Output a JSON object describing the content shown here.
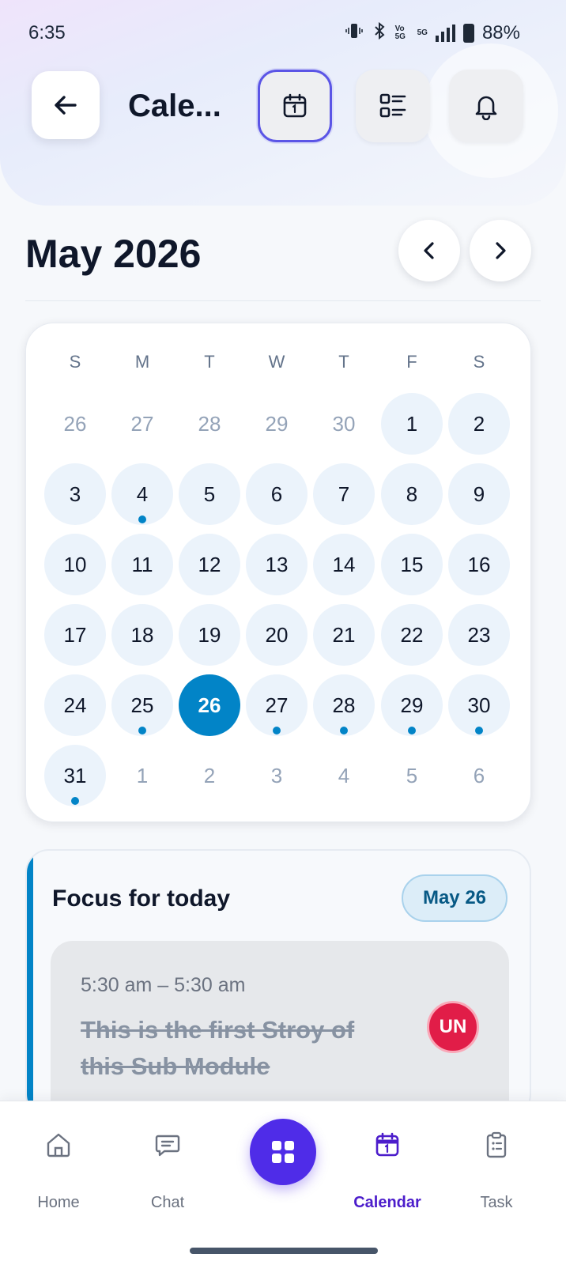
{
  "status_bar": {
    "time": "6:35",
    "network": "5G",
    "volte": "Vo 5G",
    "battery": "88%",
    "icons": [
      "vibrate-icon",
      "bluetooth-icon",
      "volte-icon",
      "signal-icon",
      "battery-icon"
    ]
  },
  "header": {
    "title": "Cale...",
    "back_icon": "arrow-left-icon",
    "buttons": [
      {
        "icon": "calendar-icon",
        "active": true
      },
      {
        "icon": "list-icon",
        "active": false
      },
      {
        "icon": "bell-icon",
        "active": false
      }
    ]
  },
  "calendar": {
    "month_label": "May 2026",
    "prev_icon": "chevron-left-icon",
    "next_icon": "chevron-right-icon",
    "weekdays": [
      "S",
      "M",
      "T",
      "W",
      "T",
      "F",
      "S"
    ],
    "selected_day": 26,
    "weeks": [
      [
        {
          "d": "26",
          "in": false
        },
        {
          "d": "27",
          "in": false
        },
        {
          "d": "28",
          "in": false
        },
        {
          "d": "29",
          "in": false
        },
        {
          "d": "30",
          "in": false
        },
        {
          "d": "1",
          "in": true
        },
        {
          "d": "2",
          "in": true
        }
      ],
      [
        {
          "d": "3",
          "in": true
        },
        {
          "d": "4",
          "in": true,
          "dot": true
        },
        {
          "d": "5",
          "in": true
        },
        {
          "d": "6",
          "in": true
        },
        {
          "d": "7",
          "in": true
        },
        {
          "d": "8",
          "in": true
        },
        {
          "d": "9",
          "in": true
        }
      ],
      [
        {
          "d": "10",
          "in": true
        },
        {
          "d": "11",
          "in": true
        },
        {
          "d": "12",
          "in": true
        },
        {
          "d": "13",
          "in": true
        },
        {
          "d": "14",
          "in": true
        },
        {
          "d": "15",
          "in": true
        },
        {
          "d": "16",
          "in": true
        }
      ],
      [
        {
          "d": "17",
          "in": true
        },
        {
          "d": "18",
          "in": true
        },
        {
          "d": "19",
          "in": true
        },
        {
          "d": "20",
          "in": true
        },
        {
          "d": "21",
          "in": true
        },
        {
          "d": "22",
          "in": true
        },
        {
          "d": "23",
          "in": true
        }
      ],
      [
        {
          "d": "24",
          "in": true
        },
        {
          "d": "25",
          "in": true,
          "dot": true
        },
        {
          "d": "26",
          "in": true,
          "selected": true
        },
        {
          "d": "27",
          "in": true,
          "dot": true
        },
        {
          "d": "28",
          "in": true,
          "dot": true
        },
        {
          "d": "29",
          "in": true,
          "dot": true
        },
        {
          "d": "30",
          "in": true,
          "dot": true
        }
      ],
      [
        {
          "d": "31",
          "in": true,
          "dot": true
        },
        {
          "d": "1",
          "in": false
        },
        {
          "d": "2",
          "in": false
        },
        {
          "d": "3",
          "in": false
        },
        {
          "d": "4",
          "in": false
        },
        {
          "d": "5",
          "in": false
        },
        {
          "d": "6",
          "in": false
        }
      ]
    ]
  },
  "focus": {
    "title": "Focus for today",
    "date_badge": "May 26",
    "task": {
      "time": "5:30 am – 5:30 am",
      "title": "This is the first Stroy of this Sub Module",
      "completed": true,
      "avatar_initials": "UN",
      "avatar_color": "#e11d48"
    }
  },
  "bottom_nav": {
    "items": [
      {
        "label": "Home",
        "icon": "home-icon",
        "active": false
      },
      {
        "label": "Chat",
        "icon": "chat-icon",
        "active": false
      },
      {
        "label": "Calendar",
        "icon": "calendar-icon",
        "active": true
      },
      {
        "label": "Task",
        "icon": "clipboard-icon",
        "active": false
      }
    ],
    "fab_icon": "grid-icon"
  },
  "colors": {
    "accent": "#0284c7",
    "primary": "#4f2ce8",
    "active_label": "#4c1dcb",
    "day_bg": "#ebf3fb"
  }
}
